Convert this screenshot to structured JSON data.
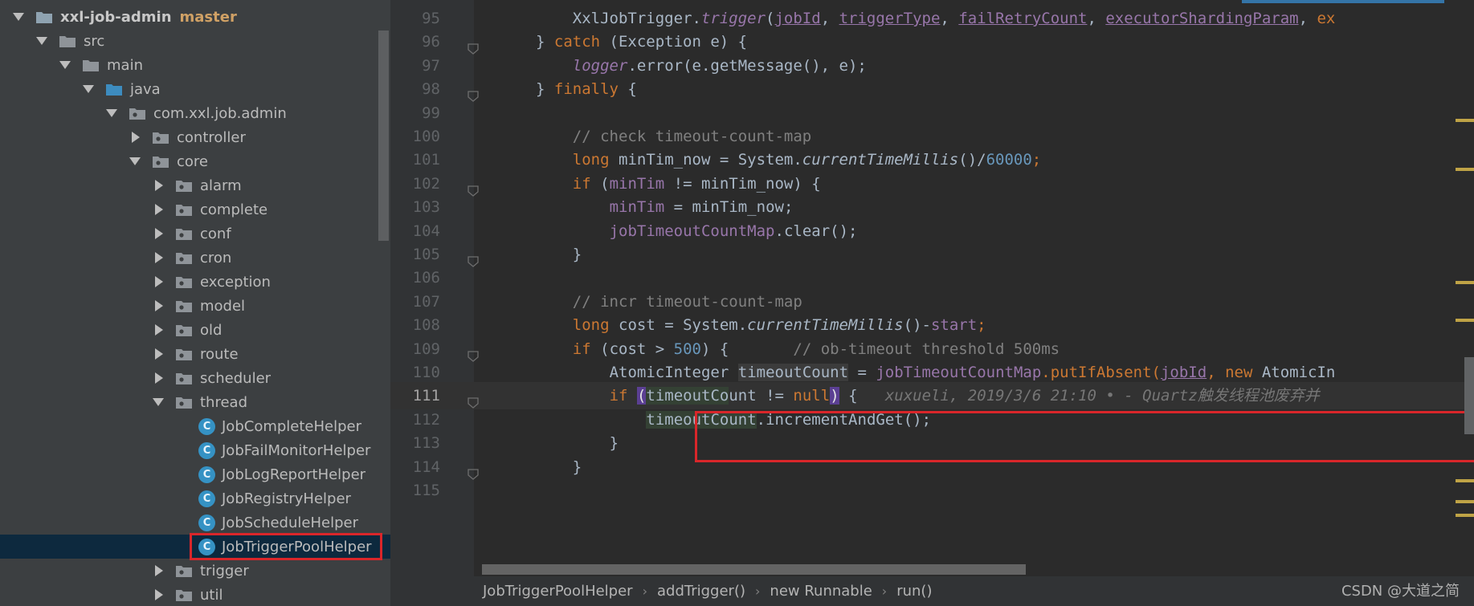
{
  "project": {
    "root": "xxl-job-admin",
    "branch": "master",
    "nodes": [
      "src",
      "main",
      "java",
      "com.xxl.job.admin",
      "controller",
      "core",
      "alarm",
      "complete",
      "conf",
      "cron",
      "exception",
      "model",
      "old",
      "route",
      "scheduler",
      "thread"
    ],
    "thread_files": [
      "JobCompleteHelper",
      "JobFailMonitorHelper",
      "JobLogReportHelper",
      "JobRegistryHelper",
      "JobScheduleHelper",
      "JobTriggerPoolHelper"
    ],
    "after": [
      "trigger",
      "util"
    ],
    "class_icon_letter": "C"
  },
  "editor": {
    "line_numbers": [
      "95",
      "96",
      "97",
      "98",
      "99",
      "100",
      "101",
      "102",
      "103",
      "104",
      "105",
      "106",
      "107",
      "108",
      "109",
      "110",
      "111",
      "112",
      "113",
      "114",
      "115"
    ],
    "current_line": "111",
    "blame": "xuxueli, 2019/3/6 21:10 • - Quartz触发线程池废弃并",
    "tokens": {
      "l95": [
        "XxlJobTrigger.",
        "trigger",
        "(",
        "jobId",
        ", ",
        "triggerType",
        ", ",
        "failRetryCount",
        ", ",
        "executorShardingParam",
        ", ",
        "ex"
      ],
      "l96": [
        "} ",
        "catch",
        " (Exception e) {"
      ],
      "l97": [
        "logger",
        ".error(e.getMessage(), e);"
      ],
      "l98": [
        "} ",
        "finally",
        " {"
      ],
      "l100": [
        "// check timeout-count-map"
      ],
      "l101": [
        "long",
        " minTim_now = System.",
        "currentTimeMillis",
        "()/",
        "60000",
        ";"
      ],
      "l102": [
        "if",
        " (",
        "minTim",
        " != minTim_now) {"
      ],
      "l103": [
        "minTim",
        " = minTim_now;"
      ],
      "l104": [
        "jobTimeoutCountMap",
        ".clear();"
      ],
      "l105": [
        "}"
      ],
      "l107": [
        "// incr timeout-count-map"
      ],
      "l108": [
        "long",
        " cost = System.",
        "currentTimeMillis",
        "()-",
        "start",
        ";"
      ],
      "l109": [
        "if",
        " (cost > ",
        "500",
        ") {",
        "// ob-timeout threshold 500ms"
      ],
      "l110": [
        "AtomicInteger ",
        "timeoutCount",
        " = ",
        "jobTimeoutCountMap",
        ".putIfAbsent(",
        "jobId",
        ", ",
        "new",
        " AtomicIn"
      ],
      "l111": [
        "if",
        " ",
        "(",
        "timeoutCo",
        "unt != ",
        "null",
        ")",
        " {"
      ],
      "l112": [
        "timeoutCount",
        ".incrementAndGet();"
      ],
      "l113": [
        "}"
      ],
      "l114": [
        "}"
      ]
    }
  },
  "breadcrumb": [
    "JobTriggerPoolHelper",
    "addTrigger()",
    "new Runnable",
    "run()"
  ],
  "watermark": "CSDN @大道之简",
  "colors": {
    "keyword": "#cc7832",
    "field": "#9876aa",
    "number": "#6897bb",
    "comment": "#808080",
    "highlight": "#d9262a"
  }
}
